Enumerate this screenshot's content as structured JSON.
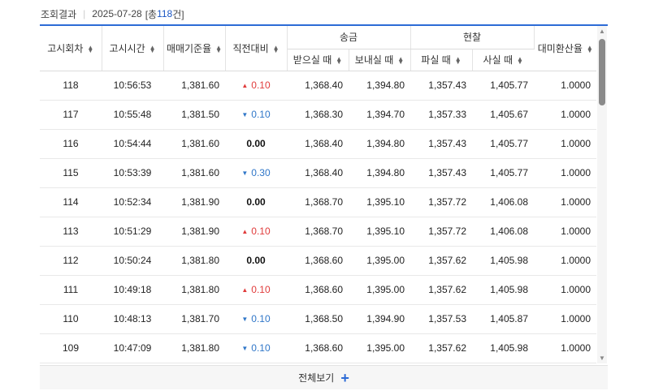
{
  "summary": {
    "label": "조회결과",
    "date": "2025-07-28",
    "count_prefix": "[총",
    "count": "118",
    "count_suffix": "건]"
  },
  "columns": {
    "round": "고시회차",
    "time": "고시시간",
    "base_rate": "매매기준율",
    "change": "직전대비",
    "remit_group": "송금",
    "remit_receive": "받으실 때",
    "remit_send": "보내실 때",
    "cash_group": "현찰",
    "cash_sell": "파실 때",
    "cash_buy": "사실 때",
    "usd_rate": "대미환산율"
  },
  "rows": [
    {
      "round": "118",
      "time": "10:56:53",
      "base_rate": "1,381.60",
      "dir": "up",
      "change": "0.10",
      "remit_receive": "1,368.40",
      "remit_send": "1,394.80",
      "cash_sell": "1,357.43",
      "cash_buy": "1,405.77",
      "usd_rate": "1.0000"
    },
    {
      "round": "117",
      "time": "10:55:48",
      "base_rate": "1,381.50",
      "dir": "down",
      "change": "0.10",
      "remit_receive": "1,368.30",
      "remit_send": "1,394.70",
      "cash_sell": "1,357.33",
      "cash_buy": "1,405.67",
      "usd_rate": "1.0000"
    },
    {
      "round": "116",
      "time": "10:54:44",
      "base_rate": "1,381.60",
      "dir": "flat",
      "change": "0.00",
      "remit_receive": "1,368.40",
      "remit_send": "1,394.80",
      "cash_sell": "1,357.43",
      "cash_buy": "1,405.77",
      "usd_rate": "1.0000"
    },
    {
      "round": "115",
      "time": "10:53:39",
      "base_rate": "1,381.60",
      "dir": "down",
      "change": "0.30",
      "remit_receive": "1,368.40",
      "remit_send": "1,394.80",
      "cash_sell": "1,357.43",
      "cash_buy": "1,405.77",
      "usd_rate": "1.0000"
    },
    {
      "round": "114",
      "time": "10:52:34",
      "base_rate": "1,381.90",
      "dir": "flat",
      "change": "0.00",
      "remit_receive": "1,368.70",
      "remit_send": "1,395.10",
      "cash_sell": "1,357.72",
      "cash_buy": "1,406.08",
      "usd_rate": "1.0000"
    },
    {
      "round": "113",
      "time": "10:51:29",
      "base_rate": "1,381.90",
      "dir": "up",
      "change": "0.10",
      "remit_receive": "1,368.70",
      "remit_send": "1,395.10",
      "cash_sell": "1,357.72",
      "cash_buy": "1,406.08",
      "usd_rate": "1.0000"
    },
    {
      "round": "112",
      "time": "10:50:24",
      "base_rate": "1,381.80",
      "dir": "flat",
      "change": "0.00",
      "remit_receive": "1,368.60",
      "remit_send": "1,395.00",
      "cash_sell": "1,357.62",
      "cash_buy": "1,405.98",
      "usd_rate": "1.0000"
    },
    {
      "round": "111",
      "time": "10:49:18",
      "base_rate": "1,381.80",
      "dir": "up",
      "change": "0.10",
      "remit_receive": "1,368.60",
      "remit_send": "1,395.00",
      "cash_sell": "1,357.62",
      "cash_buy": "1,405.98",
      "usd_rate": "1.0000"
    },
    {
      "round": "110",
      "time": "10:48:13",
      "base_rate": "1,381.70",
      "dir": "down",
      "change": "0.10",
      "remit_receive": "1,368.50",
      "remit_send": "1,394.90",
      "cash_sell": "1,357.53",
      "cash_buy": "1,405.87",
      "usd_rate": "1.0000"
    },
    {
      "round": "109",
      "time": "10:47:09",
      "base_rate": "1,381.80",
      "dir": "down",
      "change": "0.10",
      "remit_receive": "1,368.60",
      "remit_send": "1,395.00",
      "cash_sell": "1,357.62",
      "cash_buy": "1,405.98",
      "usd_rate": "1.0000"
    }
  ],
  "footer": {
    "label": "전체보기",
    "icon": "plus-icon"
  },
  "colors": {
    "accent": "#2d6bd6",
    "up": "#e03b3b",
    "down": "#2f76c8"
  }
}
